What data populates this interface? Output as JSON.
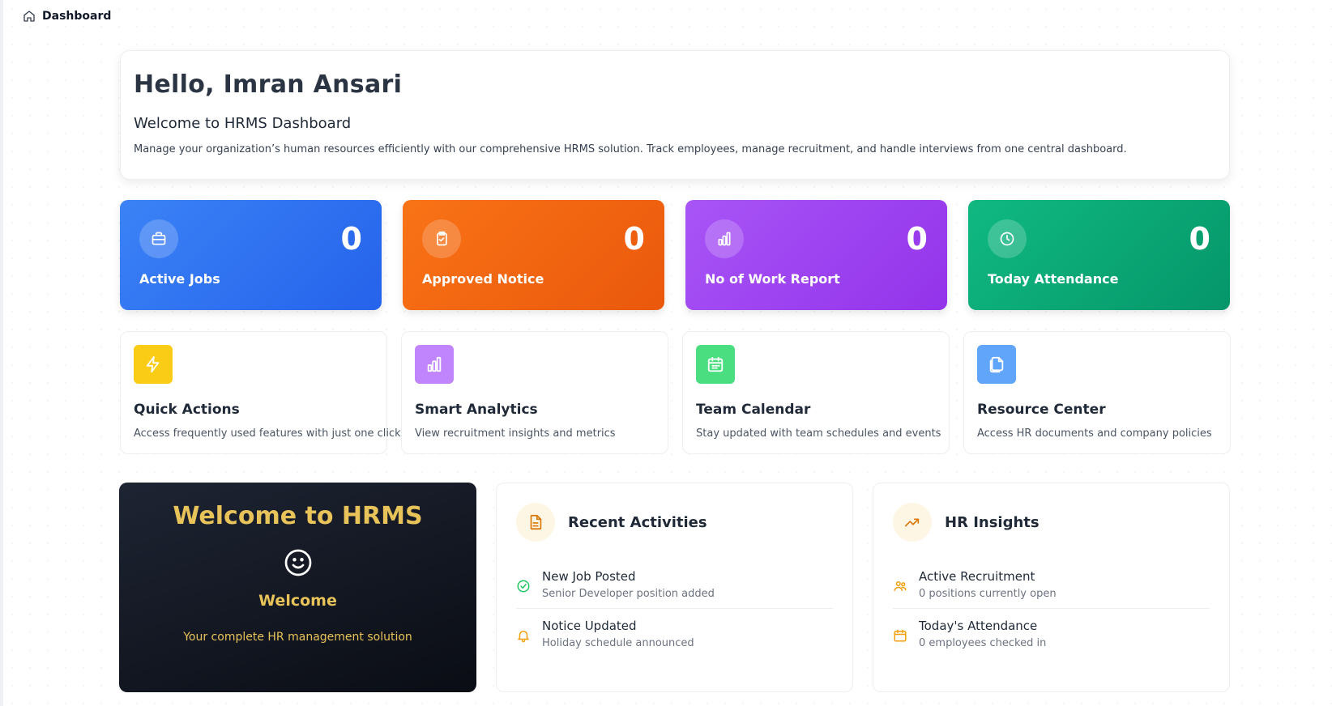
{
  "breadcrumb": {
    "label": "Dashboard",
    "icon": "home-icon"
  },
  "greeting": {
    "title": "Hello, Imran Ansari",
    "subtitle": "Welcome to HRMS Dashboard",
    "description": "Manage your organization’s human resources efficiently with our comprehensive HRMS solution. Track employees, manage recruitment, and handle interviews from one central dashboard."
  },
  "stats": [
    {
      "label": "Active Jobs",
      "value": "0",
      "icon": "briefcase-icon",
      "color": "#3b82f6"
    },
    {
      "label": "Approved Notice",
      "value": "0",
      "icon": "clipboard-check-icon",
      "color": "#f97316"
    },
    {
      "label": "No of Work Report",
      "value": "0",
      "icon": "bar-chart-icon",
      "color": "#a855f7"
    },
    {
      "label": "Today Attendance",
      "value": "0",
      "icon": "clock-icon",
      "color": "#10b981"
    }
  ],
  "features": [
    {
      "title": "Quick Actions",
      "description": "Access frequently used features with just one click",
      "icon": "lightning-icon",
      "color": "#facc15"
    },
    {
      "title": "Smart Analytics",
      "description": "View recruitment insights and metrics",
      "icon": "bar-chart-icon",
      "color": "#c084fc"
    },
    {
      "title": "Team Calendar",
      "description": "Stay updated with team schedules and events",
      "icon": "calendar-icon",
      "color": "#4ade80"
    },
    {
      "title": "Resource Center",
      "description": "Access HR documents and company policies",
      "icon": "documents-icon",
      "color": "#60a5fa"
    }
  ],
  "welcome_card": {
    "title": "Welcome to HRMS",
    "heading": "Welcome",
    "tagline": "Your complete HR management solution",
    "icon": "smile-icon",
    "accent": "#e8c35a"
  },
  "recent_activities": {
    "title": "Recent Activities",
    "icon": "document-icon",
    "items": [
      {
        "title": "New Job Posted",
        "description": "Senior Developer position added",
        "icon": "check-circle-icon"
      },
      {
        "title": "Notice Updated",
        "description": "Holiday schedule announced",
        "icon": "bell-icon"
      }
    ]
  },
  "hr_insights": {
    "title": "HR Insights",
    "icon": "trending-up-icon",
    "items": [
      {
        "title": "Active Recruitment",
        "description": "0 positions currently open",
        "icon": "users-icon"
      },
      {
        "title": "Today's Attendance",
        "description": "0 employees checked in",
        "icon": "calendar-icon"
      }
    ]
  }
}
